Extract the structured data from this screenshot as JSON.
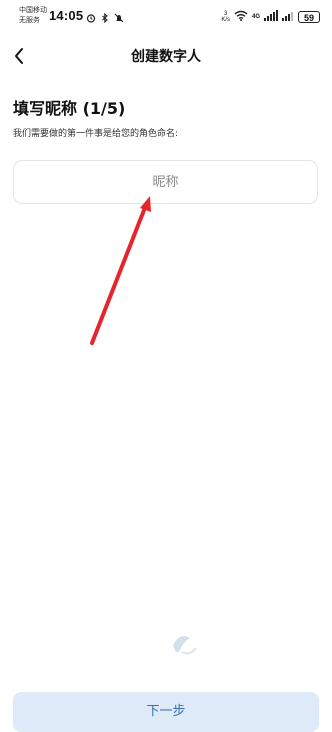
{
  "status_bar": {
    "carrier_line1": "中国移动",
    "carrier_line2": "无服务",
    "time": "14:05",
    "speed_value": "3",
    "speed_unit": "K/s",
    "network": "4G",
    "battery": "59"
  },
  "header": {
    "title": "创建数字人",
    "back_icon": "chevron-left-icon"
  },
  "form": {
    "step_title": "填写昵称 (1/5)",
    "description": "我们需要做的第一件事是给您的角色命名:",
    "nickname_placeholder": "昵称",
    "nickname_value": ""
  },
  "annotation": {
    "arrow_color": "#e5252d"
  },
  "footer": {
    "next_label": "下一步",
    "next_bg_color": "#dfeaf8",
    "next_text_color": "#3a6fb0"
  }
}
